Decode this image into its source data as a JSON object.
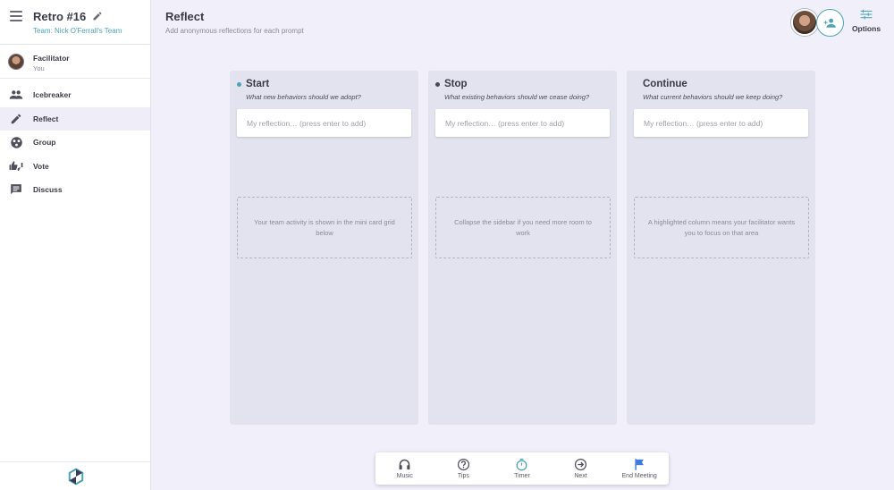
{
  "sidebar": {
    "title": "Retro #16",
    "team": "Team: Nick O'Ferrall's Team",
    "facilitator": {
      "label": "Facilitator",
      "sub": "You"
    },
    "items": [
      {
        "label": "Icebreaker",
        "icon": "group-icon"
      },
      {
        "label": "Reflect",
        "icon": "pencil-icon",
        "active": true
      },
      {
        "label": "Group",
        "icon": "group-circle-icon"
      },
      {
        "label": "Vote",
        "icon": "thumbs-icon"
      },
      {
        "label": "Discuss",
        "icon": "chat-icon"
      }
    ]
  },
  "header": {
    "title": "Reflect",
    "subtitle": "Add anonymous reflections for each prompt",
    "options_label": "Options"
  },
  "columns": [
    {
      "title": "Start",
      "prompt": "What new behaviors should we adopt?",
      "placeholder": "My reflection… (press enter to add)",
      "tip": "Your team activity is shown in the mini card grid below",
      "dot_color": "#4aa3b8"
    },
    {
      "title": "Stop",
      "prompt": "What existing behaviors should we cease doing?",
      "placeholder": "My reflection… (press enter to add)",
      "tip": "Collapse the sidebar if you need more room to work",
      "dot_color": "#4a4a56"
    },
    {
      "title": "Continue",
      "prompt": "What current behaviors should we keep doing?",
      "placeholder": "My reflection… (press enter to add)",
      "tip": "A highlighted column means your facilitator wants you to focus on that area",
      "dot_color": ""
    }
  ],
  "bottom_bar": {
    "music": "Music",
    "tips": "Tips",
    "timer": "Timer",
    "next": "Next",
    "end": "End Meeting"
  },
  "colors": {
    "accent": "#4aa3b8",
    "timer": "#4aa3b8",
    "flag": "#3d7be0"
  }
}
